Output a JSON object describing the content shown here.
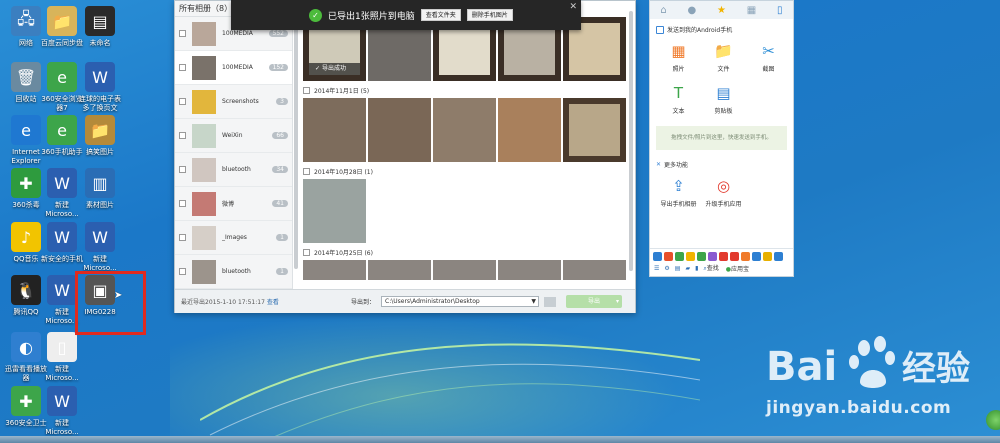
{
  "desktop": {
    "icons": [
      {
        "label": "网络",
        "glyph": "🖧",
        "color": "#3b7fc0",
        "col": 0,
        "row": 0
      },
      {
        "label": "百度云同步盘",
        "glyph": "📁",
        "color": "#d8b45a",
        "col": 1,
        "row": 0
      },
      {
        "label": "未命名",
        "glyph": "▤",
        "color": "#2a2a2a",
        "col": 2,
        "row": 0
      },
      {
        "label": "回收站",
        "glyph": "🗑",
        "color": "#6a8aa0",
        "col": 0,
        "row": 1
      },
      {
        "label": "360安全浏览器7",
        "glyph": "e",
        "color": "#3da54a",
        "col": 1,
        "row": 1
      },
      {
        "label": "连球的电子表多了换页文",
        "glyph": "W",
        "color": "#2b5fb0",
        "col": 2,
        "row": 1
      },
      {
        "label": "Internet Explorer",
        "glyph": "e",
        "color": "#1f78d1",
        "col": 0,
        "row": 2
      },
      {
        "label": "360手机助手",
        "glyph": "e",
        "color": "#3da54a",
        "col": 1,
        "row": 2
      },
      {
        "label": "搞笑图片",
        "glyph": "📁",
        "color": "#b48a3a",
        "col": 2,
        "row": 2
      },
      {
        "label": "360杀毒",
        "glyph": "✚",
        "color": "#2e9b3e",
        "col": 0,
        "row": 3
      },
      {
        "label": "新建 Microso...",
        "glyph": "W",
        "color": "#2b5fb0",
        "col": 1,
        "row": 3
      },
      {
        "label": "素材图片",
        "glyph": "▥",
        "color": "#2a6db5",
        "col": 2,
        "row": 3
      },
      {
        "label": "QQ音乐",
        "glyph": "♪",
        "color": "#f2c400",
        "col": 0,
        "row": 4
      },
      {
        "label": "新安全的手机",
        "glyph": "W",
        "color": "#2b5fb0",
        "col": 1,
        "row": 4
      },
      {
        "label": "新建 Microso...",
        "glyph": "W",
        "color": "#2b5fb0",
        "col": 2,
        "row": 4
      },
      {
        "label": "腾讯QQ",
        "glyph": "🐧",
        "color": "#222222",
        "col": 0,
        "row": 5
      },
      {
        "label": "新建 Microso...",
        "glyph": "W",
        "color": "#2b5fb0",
        "col": 1,
        "row": 5
      },
      {
        "label": "IMG0228",
        "glyph": "▣",
        "color": "#555555",
        "col": 2,
        "row": 5
      },
      {
        "label": "迅雷看看播放器",
        "glyph": "◐",
        "color": "#2f7fd0",
        "col": 0,
        "row": 6
      },
      {
        "label": "新建 Microso...",
        "glyph": "▯",
        "color": "#eeeeee",
        "col": 1,
        "row": 6
      },
      {
        "label": "360安全卫士",
        "glyph": "✚",
        "color": "#3da54a",
        "col": 0,
        "row": 7
      },
      {
        "label": "新建 Microso...",
        "glyph": "W",
        "color": "#2b5fb0",
        "col": 1,
        "row": 7
      }
    ]
  },
  "toast": {
    "message": "已导出1张照片到电脑",
    "open_folder": "查看文件夹",
    "delete_phone": "删除手机图片",
    "close": "✕"
  },
  "photo_manager": {
    "sidebar_title": "所有相册（8）",
    "albums": [
      {
        "name": "100MEDIA",
        "count": "552",
        "selected": false
      },
      {
        "name": "100MEDIA",
        "count": "152",
        "selected": true
      },
      {
        "name": "Screenshots",
        "count": "3",
        "selected": false
      },
      {
        "name": "WeiXin",
        "count": "66",
        "selected": false
      },
      {
        "name": "bluetooth",
        "count": "34",
        "selected": false
      },
      {
        "name": "微博",
        "count": "41",
        "selected": false
      },
      {
        "name": "_Images",
        "count": "1",
        "selected": false
      },
      {
        "name": "bluetooth",
        "count": "1",
        "selected": false
      }
    ],
    "export_success": "导出成功",
    "groups": [
      {
        "date": "2014年11月1日 (5)"
      },
      {
        "date": "2014年10月28日 (1)"
      },
      {
        "date": "2014年10月25日 (6)"
      }
    ],
    "footer": {
      "last_export": "最近导出2015-1-10 17:51:17",
      "view_link": "查看",
      "export_to_label": "导出到：",
      "path": "C:\\Users\\Administrator\\Desktop",
      "export_button": "导出"
    }
  },
  "phone_assistant": {
    "send_title": "发送到我的Android手机",
    "items": [
      {
        "label": "照片",
        "glyph": "▦",
        "color": "#f07a2a"
      },
      {
        "label": "文件",
        "glyph": "📁",
        "color": "#f2b400"
      },
      {
        "label": "截图",
        "glyph": "✂",
        "color": "#2f8fd6"
      },
      {
        "label": "文本",
        "glyph": "T",
        "color": "#3da54a"
      },
      {
        "label": "剪贴板",
        "glyph": "▤",
        "color": "#2d7fd2"
      }
    ],
    "drop_hint": "拖拽文件/照片到这里，快速发送到手机。",
    "more_title": "更多功能",
    "more_items": [
      {
        "label": "导出手机相册",
        "glyph": "⇪",
        "color": "#2d7fd2"
      },
      {
        "label": "升级手机应用",
        "glyph": "◎",
        "color": "#e23a2e"
      }
    ],
    "find_label": "查找",
    "store_label": "应用宝"
  },
  "watermark": {
    "brand": "Bai",
    "suffix": "经验",
    "url": "jingyan.baidu.com"
  }
}
